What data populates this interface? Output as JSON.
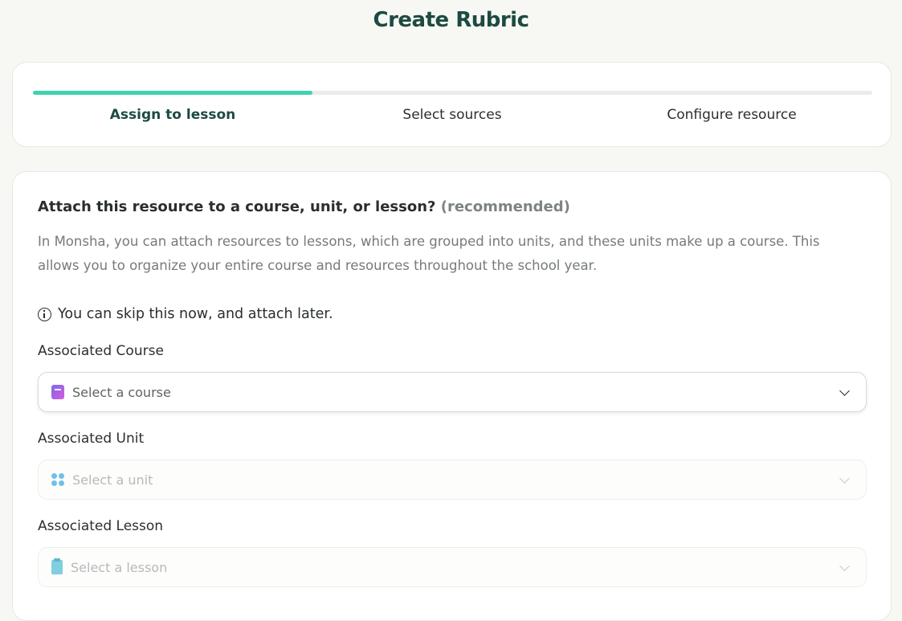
{
  "page": {
    "title": "Create Rubric"
  },
  "stepper": {
    "progress": 0.333,
    "steps": [
      {
        "label": "Assign to lesson",
        "active": true
      },
      {
        "label": "Select sources",
        "active": false
      },
      {
        "label": "Configure resource",
        "active": false
      }
    ]
  },
  "form": {
    "question": "Attach this resource to a course, unit, or lesson?",
    "recommended": "(recommended)",
    "description": "In Monsha, you can attach resources to lessons, which are grouped into units, and these units make up a course. This allows you to organize your entire course and resources throughout the school year.",
    "skip_note": "You can skip this now, and attach later.",
    "course": {
      "label": "Associated Course",
      "placeholder": "Select a course",
      "icon": "notebook-icon"
    },
    "unit": {
      "label": "Associated Unit",
      "placeholder": "Select a unit",
      "icon": "grid-dots-icon"
    },
    "lesson": {
      "label": "Associated Lesson",
      "placeholder": "Select a lesson",
      "icon": "clipboard-icon"
    }
  },
  "colors": {
    "accent": "#3ed3ae",
    "title": "#1d4a42",
    "background": "#f7f8f4"
  }
}
